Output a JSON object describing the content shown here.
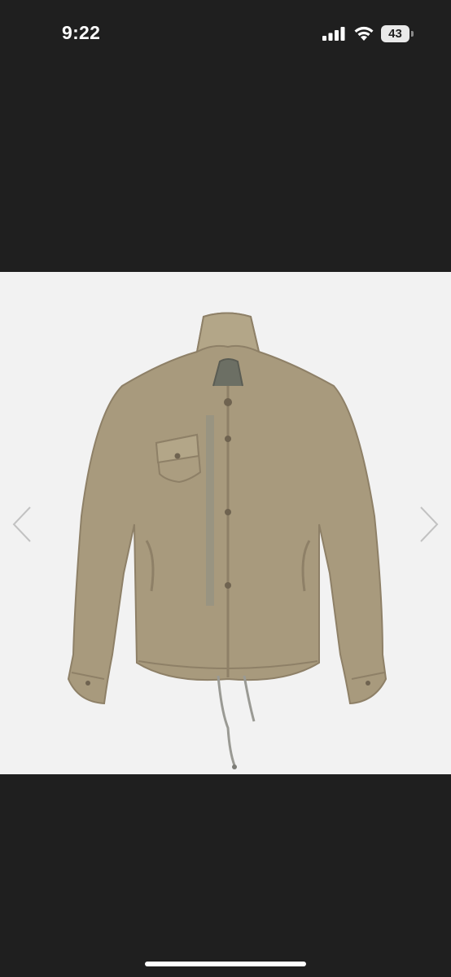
{
  "status_bar": {
    "time": "9:22",
    "battery_level": "43",
    "icons": [
      "signal-icon",
      "wifi-icon",
      "battery-icon"
    ]
  },
  "product_image": {
    "subject": "jacket",
    "background_color": "#f2f2f2",
    "controls": [
      "chevron-left-icon",
      "chevron-right-icon"
    ]
  },
  "colors": {
    "screen_background": "#1f1f1f",
    "jacket": "#a89a7d",
    "arrow": "#c2c2c2"
  }
}
